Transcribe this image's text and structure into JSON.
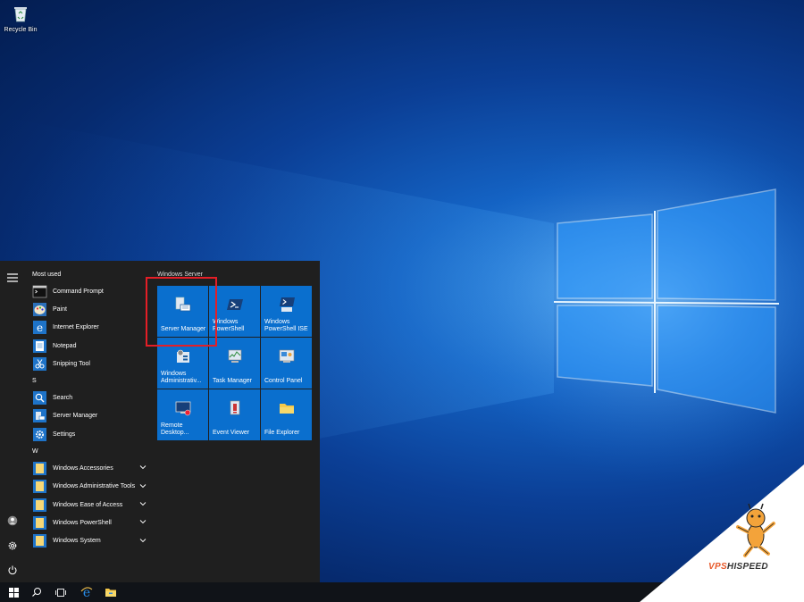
{
  "desktop": {
    "recycle_bin_label": "Recycle Bin"
  },
  "start_menu": {
    "most_used_header": "Most used",
    "most_used": [
      {
        "label": "Command Prompt",
        "icon": "command-prompt-icon"
      },
      {
        "label": "Paint",
        "icon": "paint-icon"
      },
      {
        "label": "Internet Explorer",
        "icon": "internet-explorer-icon"
      },
      {
        "label": "Notepad",
        "icon": "notepad-icon"
      },
      {
        "label": "Snipping Tool",
        "icon": "snipping-tool-icon"
      }
    ],
    "s_header": "S",
    "s_items": [
      {
        "label": "Search",
        "icon": "search-icon"
      },
      {
        "label": "Server Manager",
        "icon": "server-manager-icon"
      },
      {
        "label": "Settings",
        "icon": "gear-icon"
      }
    ],
    "w_header": "W",
    "w_items": [
      {
        "label": "Windows Accessories",
        "icon": "folder-icon"
      },
      {
        "label": "Windows Administrative Tools",
        "icon": "folder-icon"
      },
      {
        "label": "Windows Ease of Access",
        "icon": "folder-icon"
      },
      {
        "label": "Windows PowerShell",
        "icon": "folder-icon"
      },
      {
        "label": "Windows System",
        "icon": "folder-icon"
      }
    ],
    "tiles_header": "Windows Server",
    "tiles": [
      {
        "label": "Server Manager",
        "icon": "server-manager-icon"
      },
      {
        "label": "Windows PowerShell",
        "icon": "powershell-icon"
      },
      {
        "label": "Windows PowerShell ISE",
        "icon": "powershell-ise-icon"
      },
      {
        "label": "Windows Administrativ...",
        "icon": "admin-tools-icon"
      },
      {
        "label": "Task Manager",
        "icon": "task-manager-icon"
      },
      {
        "label": "Control Panel",
        "icon": "control-panel-icon"
      },
      {
        "label": "Remote Desktop...",
        "icon": "remote-desktop-icon"
      },
      {
        "label": "Event Viewer",
        "icon": "event-viewer-icon"
      },
      {
        "label": "File Explorer",
        "icon": "file-explorer-icon"
      }
    ]
  },
  "watermark": {
    "part_a": "VPS",
    "part_b": "HISPEED"
  },
  "colors": {
    "tile_blue": "#0a6fce",
    "highlight_red": "#e41e26",
    "menu_bg": "#1f1f1f",
    "taskbar_bg": "#101318"
  }
}
